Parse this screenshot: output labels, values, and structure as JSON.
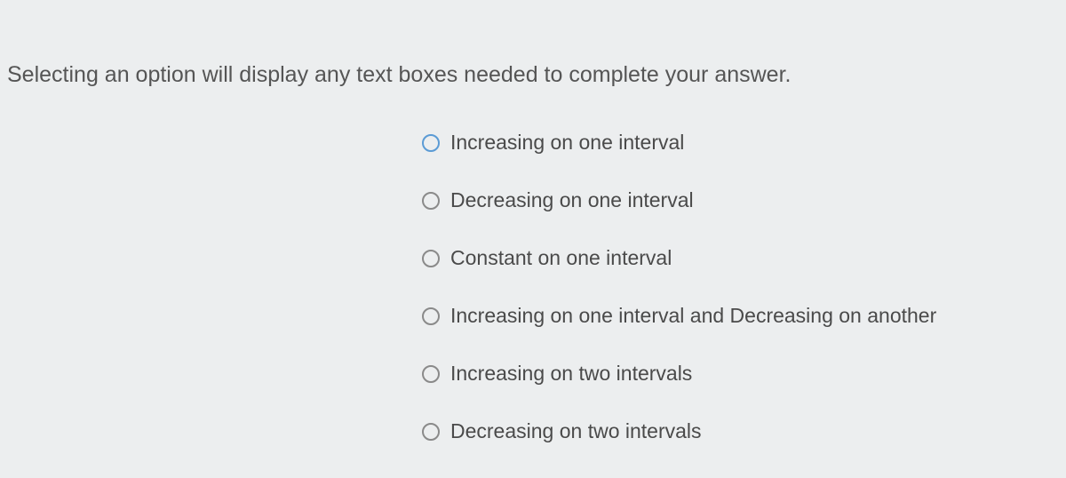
{
  "instruction": "Selecting an option will display any text boxes needed to complete your answer.",
  "options": {
    "0": {
      "label": "Increasing on one interval"
    },
    "1": {
      "label": "Decreasing on one interval"
    },
    "2": {
      "label": "Constant on one interval"
    },
    "3": {
      "label": "Increasing on one interval and Decreasing on another"
    },
    "4": {
      "label": "Increasing on two intervals"
    },
    "5": {
      "label": "Decreasing on two intervals"
    }
  }
}
